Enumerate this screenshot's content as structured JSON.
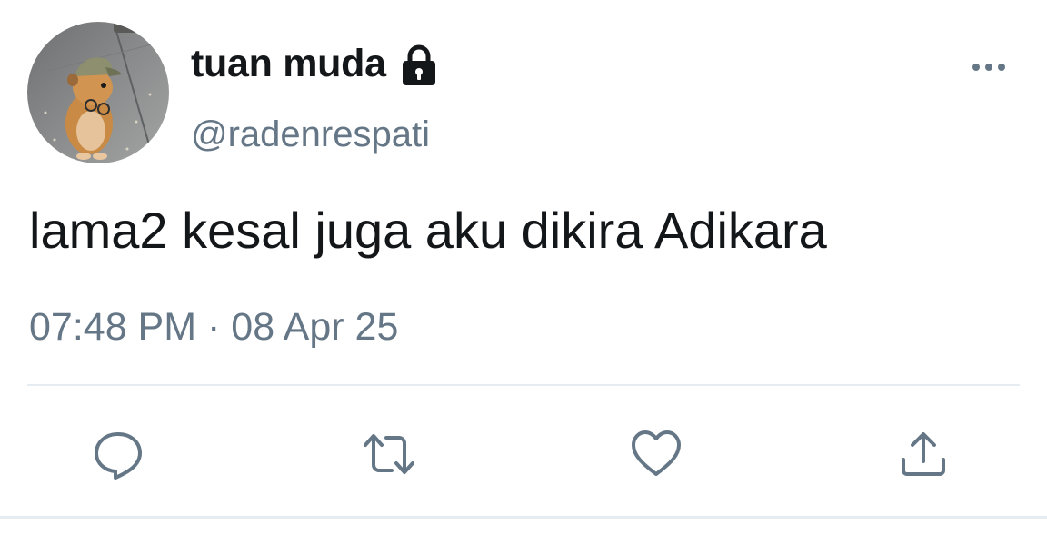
{
  "author": {
    "display_name": "tuan muda",
    "handle": "@radenrespati",
    "protected_icon": "lock-icon",
    "avatar_icon": "hamster-avatar"
  },
  "tweet": {
    "text": "lama2 kesal juga aku dikira Adikara",
    "time": "07:48 PM",
    "separator": " · ",
    "date": "08 Apr 25"
  },
  "actions": [
    {
      "name": "reply",
      "icon": "speech-bubble-icon"
    },
    {
      "name": "retweet",
      "icon": "retweet-arrows-icon"
    },
    {
      "name": "like",
      "icon": "heart-icon"
    },
    {
      "name": "share",
      "icon": "share-upload-icon"
    }
  ],
  "menu_icon": "more-dots-icon",
  "colors": {
    "primary_text": "#14171a",
    "secondary_text": "#657786",
    "divider": "#e6ecf0"
  }
}
